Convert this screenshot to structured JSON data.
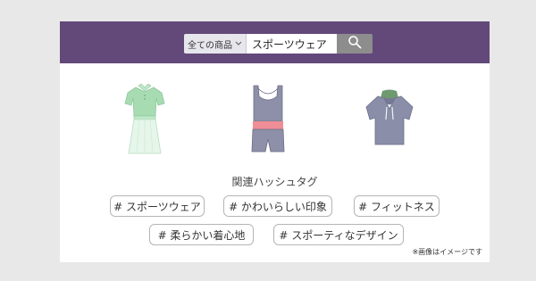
{
  "search": {
    "category": "全ての商品",
    "query": "スポーツウェア"
  },
  "icons": {
    "chevron": "chevron-down-icon",
    "search": "search-icon"
  },
  "colors": {
    "header": "#62497a",
    "search_button": "#8d8d8d"
  },
  "products": [
    {
      "name": "tennis-dress-icon",
      "color": "#a7dcb3"
    },
    {
      "name": "tank-romper-icon",
      "color": "#8d90a8"
    },
    {
      "name": "hoodie-tshirt-icon",
      "color": "#8a8ea8"
    }
  ],
  "hashtags": {
    "title": "関連ハッシュタグ",
    "items": [
      "# スポーツウェア",
      "# かわいらしい印象",
      "# フィットネス",
      "# 柔らかい着心地",
      "# スポーティなデザイン"
    ]
  },
  "note": "※画像はイメージです"
}
